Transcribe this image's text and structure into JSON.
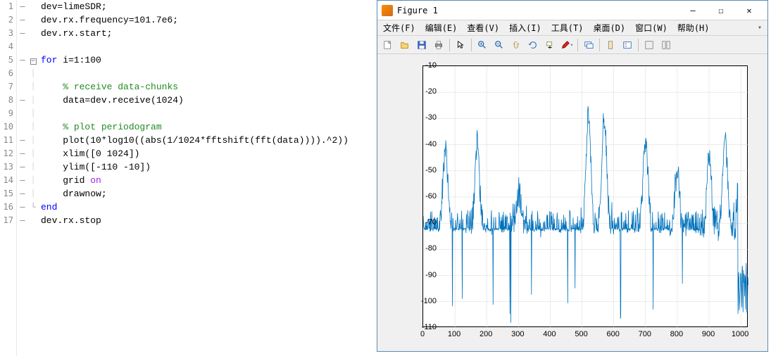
{
  "editor": {
    "lines": [
      {
        "n": 1,
        "dash": "—",
        "fold": "",
        "html": "dev=limeSDR;"
      },
      {
        "n": 2,
        "dash": "—",
        "fold": "",
        "html": "dev.rx.frequency=101.7e6;"
      },
      {
        "n": 3,
        "dash": "—",
        "fold": "",
        "html": "dev.rx.start;"
      },
      {
        "n": 4,
        "dash": "",
        "fold": "",
        "html": ""
      },
      {
        "n": 5,
        "dash": "—",
        "fold": "box",
        "html": "<span class='kw'>for</span> i=1:100"
      },
      {
        "n": 6,
        "dash": "",
        "fold": "",
        "html": ""
      },
      {
        "n": 7,
        "dash": "",
        "fold": "",
        "html": "    <span class='comment'>% receive data-chunks</span>"
      },
      {
        "n": 8,
        "dash": "—",
        "fold": "",
        "html": "    data=dev.receive(1024)"
      },
      {
        "n": 9,
        "dash": "",
        "fold": "",
        "html": ""
      },
      {
        "n": 10,
        "dash": "",
        "fold": "",
        "html": "    <span class='comment'>% plot periodogram</span>"
      },
      {
        "n": 11,
        "dash": "—",
        "fold": "",
        "html": "    plot(10*log10((abs(1/1024*fftshift(fft(data)))).^2))"
      },
      {
        "n": 12,
        "dash": "—",
        "fold": "",
        "html": "    xlim([0 1024])"
      },
      {
        "n": 13,
        "dash": "—",
        "fold": "",
        "html": "    ylim([-110 -10])"
      },
      {
        "n": 14,
        "dash": "—",
        "fold": "",
        "html": "    grid <span class='on'>on</span>"
      },
      {
        "n": 15,
        "dash": "—",
        "fold": "",
        "html": "    drawnow;"
      },
      {
        "n": 16,
        "dash": "—",
        "fold": "end",
        "html": "<span class='kw'>end</span>"
      },
      {
        "n": 17,
        "dash": "—",
        "fold": "",
        "html": "dev.rx.stop"
      }
    ]
  },
  "figure": {
    "title": "Figure 1",
    "menu": [
      "文件(F)",
      "编辑(E)",
      "查看(V)",
      "插入(I)",
      "工具(T)",
      "桌面(D)",
      "窗口(W)",
      "帮助(H)"
    ],
    "winbtns": {
      "min": "—",
      "max": "☐",
      "close": "✕"
    }
  },
  "chart_data": {
    "type": "line",
    "xlim": [
      0,
      1024
    ],
    "ylim": [
      -110,
      -10
    ],
    "xticks": [
      0,
      100,
      200,
      300,
      400,
      500,
      600,
      700,
      800,
      900,
      1000
    ],
    "yticks": [
      -10,
      -20,
      -30,
      -40,
      -50,
      -60,
      -70,
      -80,
      -90,
      -100,
      -110
    ],
    "xlabel": "",
    "ylabel": "",
    "title": "",
    "grid": true,
    "color": "#0072bd",
    "peaks": [
      {
        "x": 70,
        "y": -42
      },
      {
        "x": 170,
        "y": -40
      },
      {
        "x": 300,
        "y": -58
      },
      {
        "x": 520,
        "y": -29
      },
      {
        "x": 570,
        "y": -30
      },
      {
        "x": 700,
        "y": -38
      },
      {
        "x": 800,
        "y": -50
      },
      {
        "x": 900,
        "y": -45
      },
      {
        "x": 950,
        "y": -38
      },
      {
        "x": 1000,
        "y": -30
      }
    ],
    "baseline": -75,
    "noise_amplitude": 10,
    "lowest_dip": -105
  }
}
